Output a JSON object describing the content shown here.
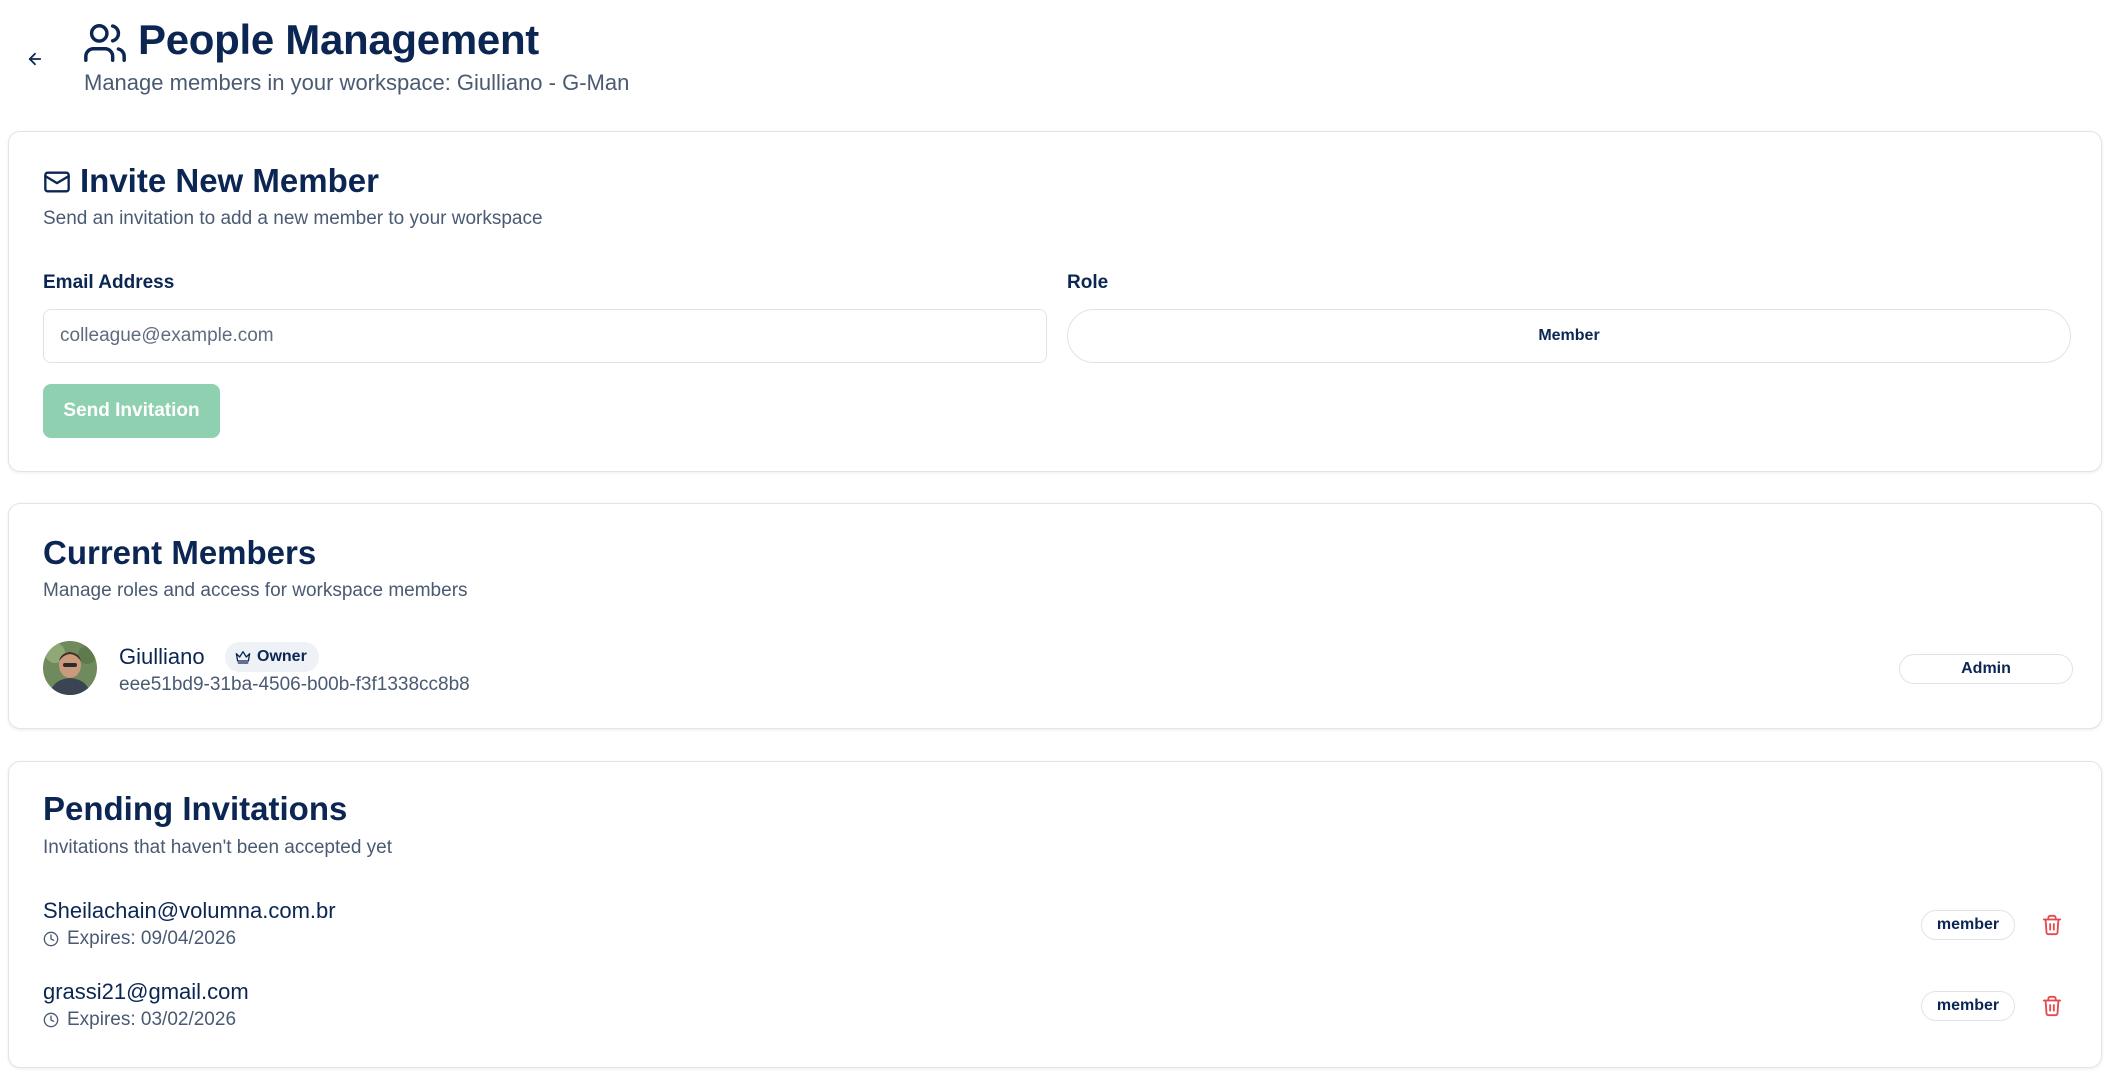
{
  "header": {
    "title": "People Management",
    "subtitle": "Manage members in your workspace: Giulliano - G-Man",
    "back_icon": "arrow-left-icon",
    "title_icon": "users-icon"
  },
  "invite": {
    "icon": "mail-icon",
    "title": "Invite New Member",
    "description": "Send an invitation to add a new member to your workspace",
    "email_label": "Email Address",
    "email_placeholder": "colleague@example.com",
    "email_value": "",
    "role_label": "Role",
    "role_value": "Member",
    "send_label": "Send Invitation"
  },
  "members": {
    "title": "Current Members",
    "description": "Manage roles and access for workspace members",
    "items": [
      {
        "name": "Giulliano",
        "badge": "Owner",
        "badge_icon": "crown-icon",
        "id": "eee51bd9-31ba-4506-b00b-f3f1338cc8b8",
        "role": "Admin"
      }
    ]
  },
  "pending": {
    "title": "Pending Invitations",
    "description": "Invitations that haven't been accepted yet",
    "items": [
      {
        "email": "Sheilachain@volumna.com.br",
        "expires": "Expires: 09/04/2026",
        "role": "member"
      },
      {
        "email": "grassi21@gmail.com",
        "expires": "Expires: 03/02/2026",
        "role": "member"
      }
    ]
  },
  "colors": {
    "primary_text": "#0b2653",
    "muted_text": "#4a5a72",
    "send_button_disabled": "#8fd0b1",
    "delete_red": "#e5484d",
    "border": "#dfe3e9"
  }
}
